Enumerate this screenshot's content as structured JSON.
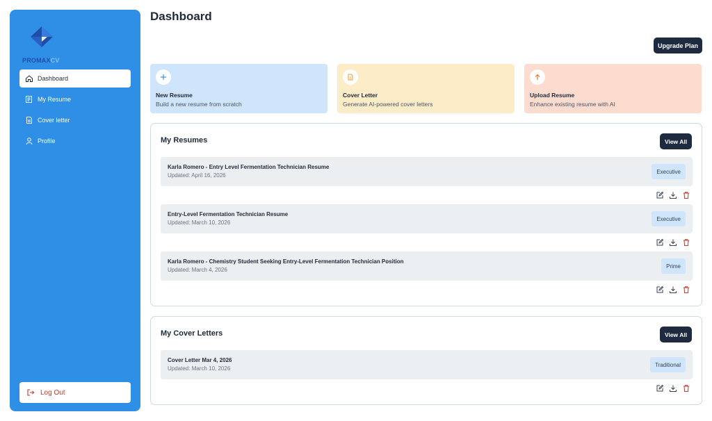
{
  "brand": {
    "name_primary": "PROMAX",
    "name_secondary": "CV"
  },
  "sidebar": {
    "items": [
      {
        "label": "Dashboard",
        "icon": "home-icon",
        "active": true
      },
      {
        "label": "My Resume",
        "icon": "resume-icon",
        "active": false
      },
      {
        "label": "Cover letter",
        "icon": "document-icon",
        "active": false
      },
      {
        "label": "Profile",
        "icon": "user-icon",
        "active": false
      }
    ],
    "logout_label": "Log Out"
  },
  "header": {
    "title": "Dashboard",
    "upgrade_label": "Upgrade Plan"
  },
  "cards": [
    {
      "title": "New Resume",
      "desc": "Build a new resume from scratch",
      "icon": "plus-icon",
      "color": "#cfe5fb"
    },
    {
      "title": "Cover Letter",
      "desc": "Generate AI-powered cover letters",
      "icon": "document-icon",
      "color": "#fdecc8"
    },
    {
      "title": "Upload Resume",
      "desc": "Enhance existing resume with AI",
      "icon": "arrow-up-icon",
      "color": "#fddcd0"
    }
  ],
  "resumes": {
    "title": "My Resumes",
    "view_all": "View All",
    "items": [
      {
        "title": "Karla Romero - Entry Level Fermentation Technician Resume",
        "updated": "Updated: April 16, 2026",
        "badge": "Executive"
      },
      {
        "title": "Entry-Level Fermentation Technician Resume",
        "updated": "Updated: March 10, 2026",
        "badge": "Executive"
      },
      {
        "title": "Karla Romero - Chemistry Student Seeking Entry-Level Fermentation Technician Position",
        "updated": "Updated: March 4, 2026",
        "badge": "Prime"
      }
    ]
  },
  "cover_letters": {
    "title": "My Cover Letters",
    "view_all": "View All",
    "items": [
      {
        "title": "Cover Letter Mar 4, 2026",
        "updated": "Updated: March 10, 2026",
        "badge": "Traditional"
      }
    ]
  },
  "colors": {
    "sidebar": "#2f8fe6",
    "dark_button": "#1e2a3f",
    "delete": "#c0392b"
  }
}
